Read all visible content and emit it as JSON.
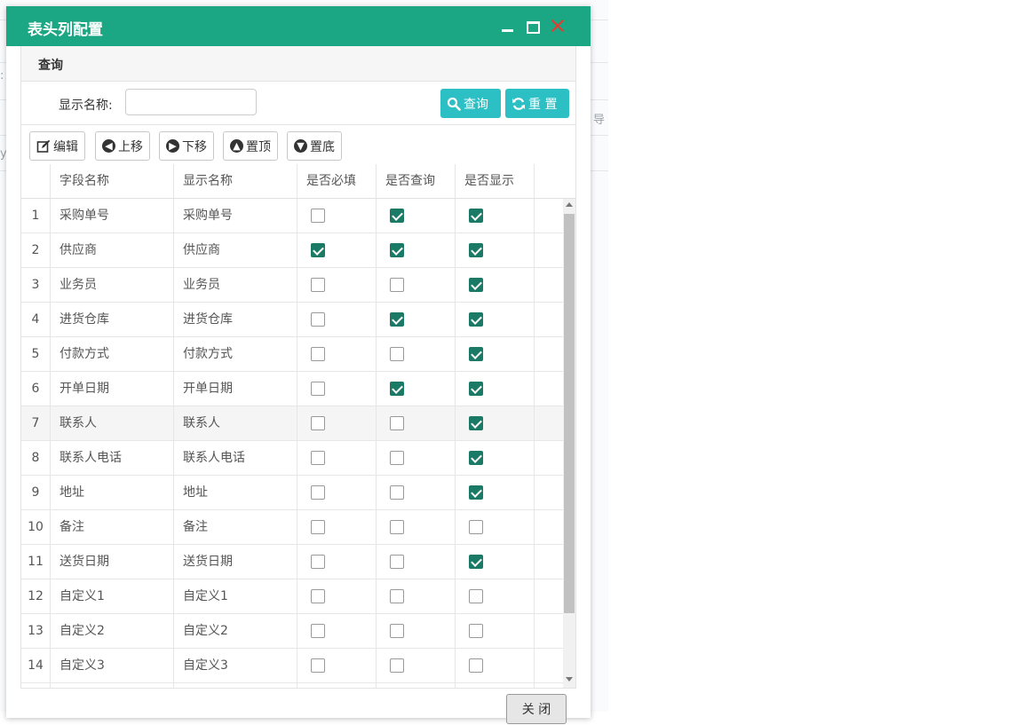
{
  "background": {
    "fragments": [
      ":",
      "导",
      "y"
    ]
  },
  "dialog": {
    "title": "表头列配置",
    "query_section_title": "查询",
    "display_name_label": "显示名称:",
    "display_name_value": "",
    "search_label": "查询",
    "reset_label": "重 置",
    "toolbar": {
      "edit": "编辑",
      "move_up": "上移",
      "move_down": "下移",
      "move_top": "置顶",
      "move_bottom": "置底"
    },
    "columns": [
      "",
      "字段名称",
      "显示名称",
      "是否必填",
      "是否查询",
      "是否显示"
    ],
    "rows": [
      {
        "no": "1",
        "field": "采购单号",
        "display": "采购单号",
        "required": false,
        "query": true,
        "show": true
      },
      {
        "no": "2",
        "field": "供应商",
        "display": "供应商",
        "required": true,
        "query": true,
        "show": true
      },
      {
        "no": "3",
        "field": "业务员",
        "display": "业务员",
        "required": false,
        "query": false,
        "show": true
      },
      {
        "no": "4",
        "field": "进货仓库",
        "display": "进货仓库",
        "required": false,
        "query": true,
        "show": true
      },
      {
        "no": "5",
        "field": "付款方式",
        "display": "付款方式",
        "required": false,
        "query": false,
        "show": true
      },
      {
        "no": "6",
        "field": "开单日期",
        "display": "开单日期",
        "required": false,
        "query": true,
        "show": true
      },
      {
        "no": "7",
        "field": "联系人",
        "display": "联系人",
        "required": false,
        "query": false,
        "show": true,
        "highlighted": true
      },
      {
        "no": "8",
        "field": "联系人电话",
        "display": "联系人电话",
        "required": false,
        "query": false,
        "show": true
      },
      {
        "no": "9",
        "field": "地址",
        "display": "地址",
        "required": false,
        "query": false,
        "show": true
      },
      {
        "no": "10",
        "field": "备注",
        "display": "备注",
        "required": false,
        "query": false,
        "show": false
      },
      {
        "no": "11",
        "field": "送货日期",
        "display": "送货日期",
        "required": false,
        "query": false,
        "show": true
      },
      {
        "no": "12",
        "field": "自定义1",
        "display": "自定义1",
        "required": false,
        "query": false,
        "show": false
      },
      {
        "no": "13",
        "field": "自定义2",
        "display": "自定义2",
        "required": false,
        "query": false,
        "show": false
      },
      {
        "no": "14",
        "field": "自定义3",
        "display": "自定义3",
        "required": false,
        "query": false,
        "show": false
      },
      {
        "no": "",
        "field": "",
        "display": "",
        "required": false,
        "query": false,
        "show": false,
        "partial": true
      }
    ],
    "close_label": "关 闭",
    "colors": {
      "titlebar": "#1ba784",
      "teal_button": "#2cbfc4",
      "checkbox_checked": "#1a7a66",
      "close_icon": "#e33b2e"
    }
  }
}
